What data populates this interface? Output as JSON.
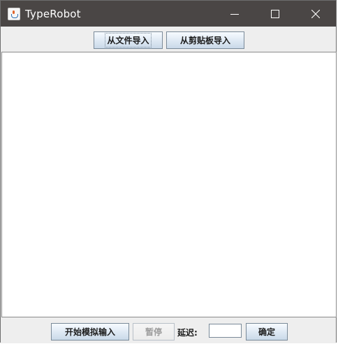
{
  "window": {
    "title": "TypeRobot",
    "controls": {
      "minimize": "minimize-icon",
      "maximize": "maximize-icon",
      "close": "close-icon"
    }
  },
  "toolbar": {
    "import_file_label": "从文件导入",
    "import_clipboard_label": "从剪贴板导入"
  },
  "editor": {
    "content": ""
  },
  "footer": {
    "start_label": "开始模拟输入",
    "pause_label": "暂停",
    "delay_label": "延迟:",
    "delay_value": "",
    "confirm_label": "确定"
  },
  "colors": {
    "titlebar_bg": "#4a4645",
    "window_bg": "#eeeeee",
    "editor_bg": "#ffffff"
  }
}
